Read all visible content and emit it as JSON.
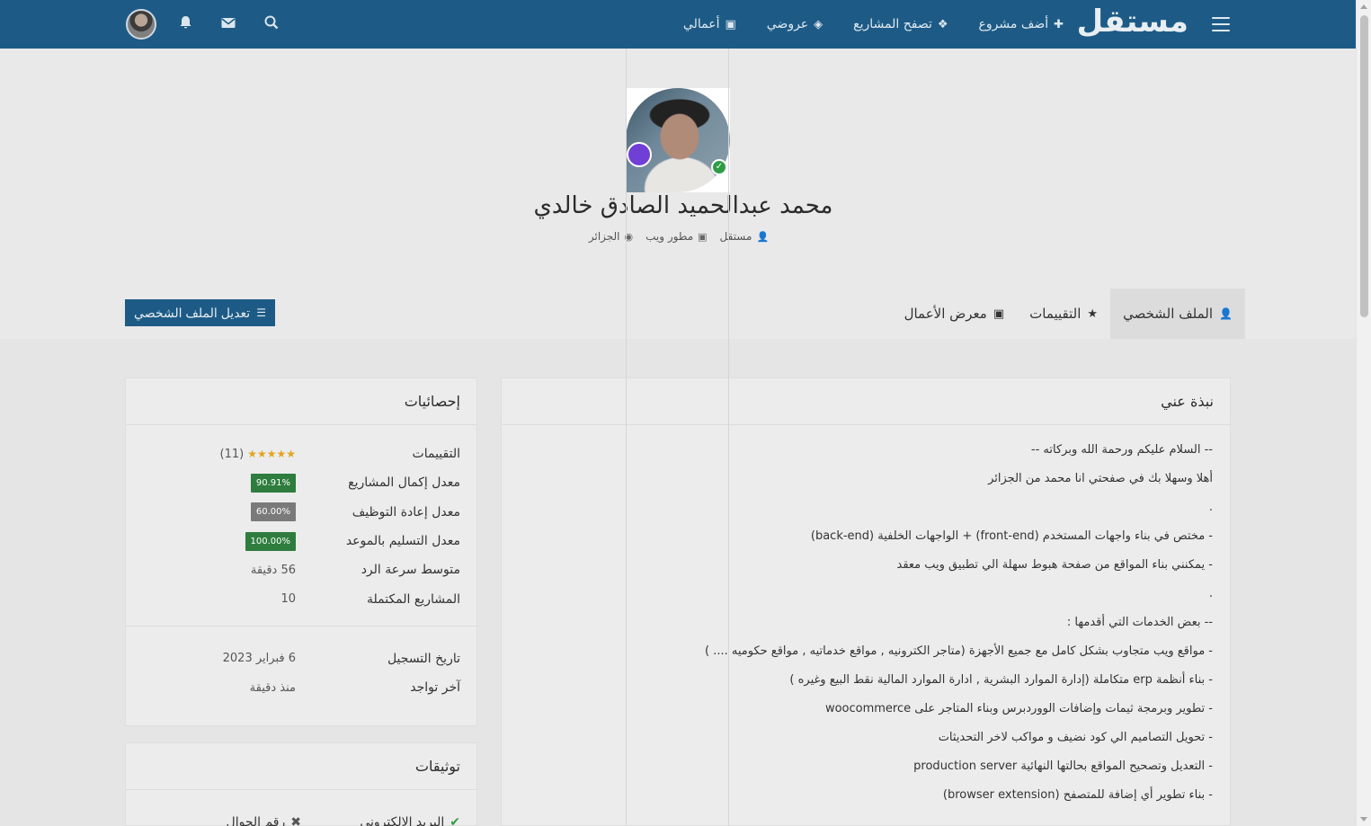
{
  "header": {
    "logo": "مستقل",
    "nav": [
      {
        "label": "أضف مشروع",
        "icon": "plus-icon",
        "glyph": "✚"
      },
      {
        "label": "تصفح المشاريع",
        "icon": "cubes-icon",
        "glyph": "❖"
      },
      {
        "label": "عروضي",
        "icon": "ticket-icon",
        "glyph": "◈"
      },
      {
        "label": "أعمالي",
        "icon": "briefcase-icon",
        "glyph": "▣"
      }
    ],
    "icons": {
      "search": "⚲",
      "mail": "✉",
      "bell": "🔔"
    }
  },
  "profile": {
    "name": "محمد عبدالحميد الصادق خالدي",
    "role_type": "مستقل",
    "job": "مطور ويب",
    "location": "الجزائر",
    "verified_mark": "✓"
  },
  "tabs": [
    {
      "label": "الملف الشخصي",
      "glyph": "👤"
    },
    {
      "label": "التقييمات",
      "glyph": "★"
    },
    {
      "label": "معرض الأعمال",
      "glyph": "▣"
    }
  ],
  "edit_button": {
    "label": "تعديل الملف الشخصي",
    "glyph": "☰"
  },
  "about": {
    "title": "نبذة عني",
    "lines": [
      "-- السلام عليكم ورحمة الله وبركاته --",
      "أهلا وسهلا بك في صفحتي انا محمد من الجزائر",
      ".",
      "- مختص في بناء واجهات المستخدم (front-end) + الواجهات الخلفية (back-end)",
      "- يمكنني بناء المواقع من صفحة هبوط سهلة الي تطبيق ويب معقد",
      ".",
      "-- بعض الخدمات التي أقدمها :",
      "- مواقع ويب متجاوب بشكل كامل مع جميع الأجهزة (متاجر الكترونيه , مواقع خدماتيه , مواقع حكوميه .... )",
      "- بناء أنظمة erp متكاملة (إدارة الموارد البشرية , ادارة الموارد المالية نقط البيع وغيره )",
      "- تطوير وبرمجة ثيمات وإضافات الووردبرس وبناء المتاجر على woocommerce",
      "- تحويل التصاميم الي كود نضيف و مواكب لاخر التحديثات",
      "- التعديل وتصحيح المواقع بحالتها النهائية production server",
      "- بناء تطوير أي إضافة للمتصفح (browser extension)"
    ]
  },
  "stats": {
    "title": "إحصائيات",
    "ratings_label": "التقييمات",
    "ratings_stars": "★★★★★",
    "ratings_count": "(11)",
    "rows": [
      {
        "label": "معدل إكمال المشاريع",
        "value": "90.91%",
        "color": "#2e7d3e"
      },
      {
        "label": "معدل إعادة التوظيف",
        "value": "60.00%",
        "color": "#7a7a7a"
      },
      {
        "label": "معدل التسليم بالموعد",
        "value": "100.00%",
        "color": "#2e7d3e"
      }
    ],
    "response_label": "متوسط سرعة الرد",
    "response_value": "56 دقيقة",
    "completed_label": "المشاريع المكتملة",
    "completed_value": "10",
    "registered_label": "تاريخ التسجيل",
    "registered_value": "6 فبراير 2023",
    "last_seen_label": "آخر تواجد",
    "last_seen_value": "منذ دقيقة"
  },
  "verifications": {
    "title": "توثيقات",
    "email": "البريد الالكتروني",
    "phone": "رقم الجوال",
    "ok_glyph": "✔",
    "no_glyph": "✖"
  }
}
